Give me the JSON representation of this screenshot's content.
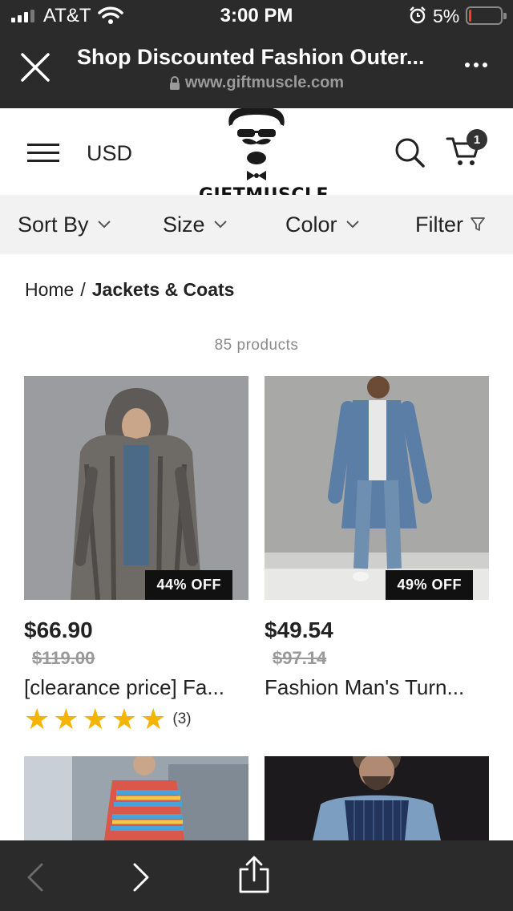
{
  "status_bar": {
    "carrier": "AT&T",
    "time": "3:00 PM",
    "battery_percent": "5%",
    "battery_level": 0.05,
    "signal_bars": 3
  },
  "browser": {
    "title": "Shop Discounted Fashion Outer...",
    "url": "www.giftmuscle.com"
  },
  "site_header": {
    "currency": "USD",
    "logo_text": "GIFTMUSCLE",
    "cart_count": "1"
  },
  "filters": {
    "sort_label": "Sort By",
    "size_label": "Size",
    "color_label": "Color",
    "filter_label": "Filter"
  },
  "breadcrumb": {
    "home": "Home",
    "separator": "/",
    "current": "Jackets & Coats"
  },
  "product_count": "85 products",
  "products": [
    {
      "badge": "44% OFF",
      "price": "$66.90",
      "compare_price": "$119.00",
      "name": "[clearance price] Fa...",
      "rating": 5,
      "review_count": "(3)"
    },
    {
      "badge": "49% OFF",
      "price": "$49.54",
      "compare_price": "$97.14",
      "name": "Fashion Man's Turn..."
    }
  ],
  "colors": {
    "dark_bar": "#2b2b2b",
    "star": "#f4b400",
    "badge_bg": "#111111",
    "filter_bg": "#f2f2f2",
    "battery_low": "#ff3b30"
  }
}
